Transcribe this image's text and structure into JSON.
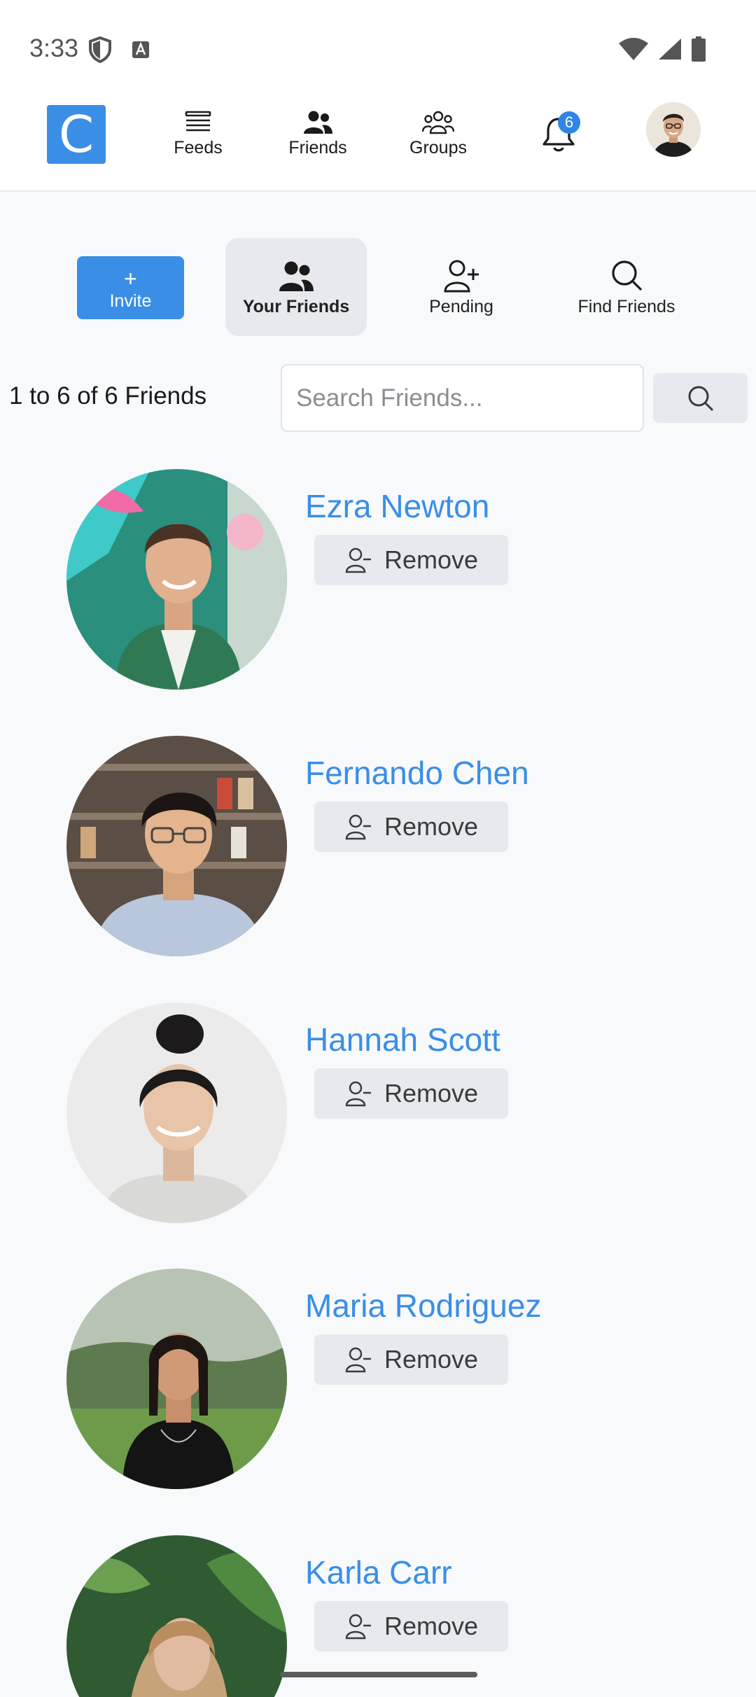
{
  "status_bar": {
    "time": "3:33"
  },
  "header": {
    "logo_letter": "C",
    "nav": [
      {
        "label": "Feeds"
      },
      {
        "label": "Friends"
      },
      {
        "label": "Groups"
      }
    ],
    "notification_count": "6"
  },
  "tabs": {
    "invite_plus": "+",
    "invite_label": "Invite",
    "your_friends": "Your Friends",
    "pending": "Pending",
    "find_friends": "Find Friends",
    "active": "Your Friends"
  },
  "list": {
    "count_text": "1 to 6 of 6 Friends",
    "search_placeholder": "Search Friends..."
  },
  "friends": [
    {
      "name": "Ezra Newton",
      "action": "Remove"
    },
    {
      "name": "Fernando Chen",
      "action": "Remove"
    },
    {
      "name": "Hannah Scott",
      "action": "Remove"
    },
    {
      "name": "Maria Rodriguez",
      "action": "Remove"
    },
    {
      "name": "Karla Carr",
      "action": "Remove"
    }
  ],
  "colors": {
    "accent": "#3a8ee6",
    "button_gray": "#e7e9ee",
    "background": "#f7f9fb"
  }
}
